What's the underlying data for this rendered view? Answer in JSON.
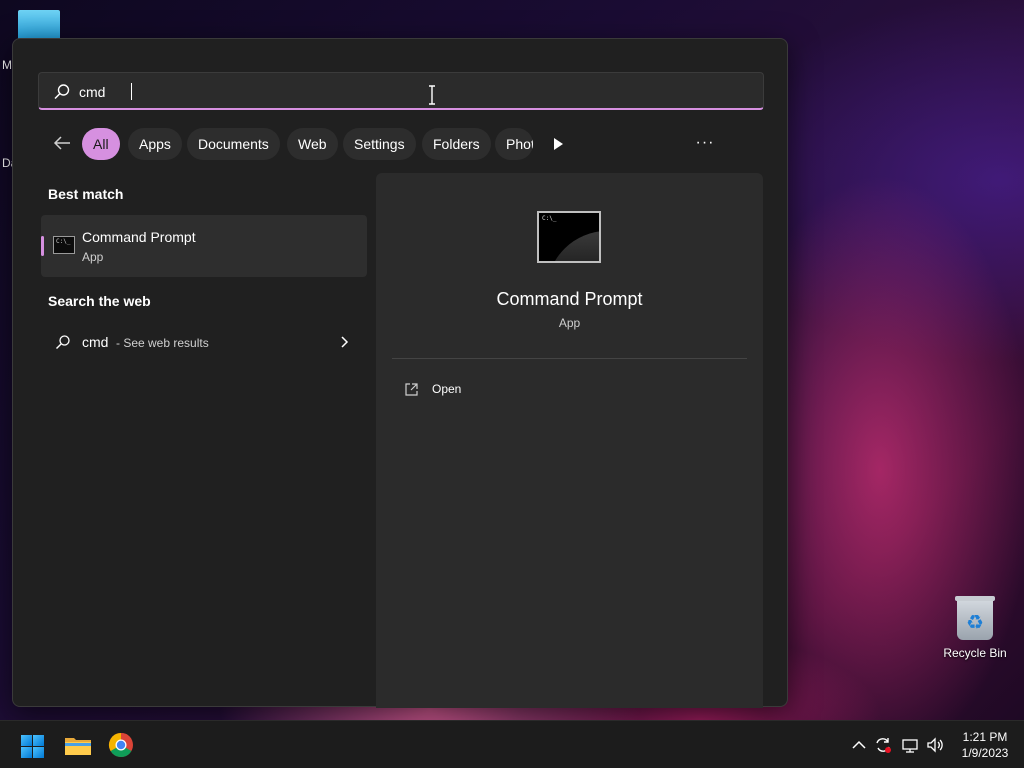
{
  "desktop": {
    "edge_letters": [
      "M",
      "Da"
    ],
    "recycle_bin_label": "Recycle Bin"
  },
  "search": {
    "query": "cmd",
    "accent_color": "#d690e0"
  },
  "filters": {
    "chips": [
      "All",
      "Apps",
      "Documents",
      "Web",
      "Settings",
      "Folders",
      "Photos"
    ],
    "active": "All",
    "more": "···"
  },
  "results": {
    "best_match_title": "Best match",
    "best_match": {
      "name": "Command Prompt",
      "type": "App"
    },
    "web_title": "Search the web",
    "web": {
      "term": "cmd",
      "suffix": "- See web results"
    }
  },
  "detail": {
    "name": "Command Prompt",
    "type": "App",
    "actions": [
      "Open"
    ]
  },
  "taskbar": {
    "time": "1:21 PM",
    "date": "1/9/2023"
  }
}
